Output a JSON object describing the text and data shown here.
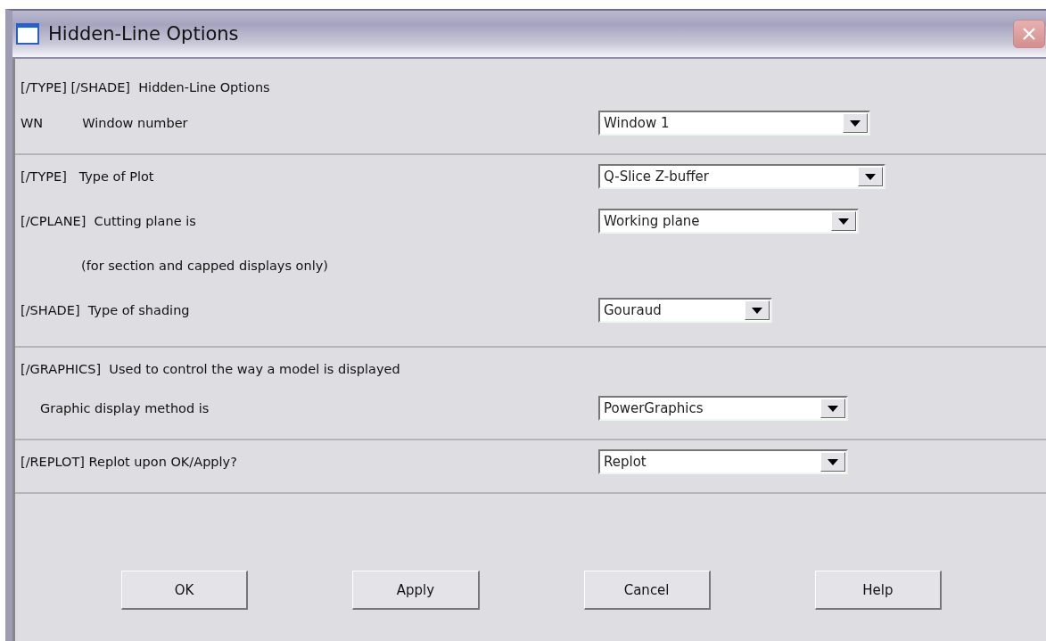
{
  "window": {
    "title": "Hidden-Line Options"
  },
  "sections": [
    {
      "rows": [
        {
          "kind": "heading",
          "label": "[/TYPE] [/SHADE]  Hidden-Line Options"
        },
        {
          "kind": "field",
          "label": "WN",
          "description": "Window number",
          "select": {
            "value": "Window 1"
          }
        }
      ]
    },
    {
      "rows": [
        {
          "kind": "field",
          "label": "[/TYPE]   Type of Plot",
          "select": {
            "value": "Q-Slice Z-buffer"
          }
        },
        {
          "kind": "field",
          "label": "[/CPLANE]  Cutting plane is",
          "select": {
            "value": "Working plane"
          }
        },
        {
          "kind": "note",
          "label": "(for section and capped displays only)"
        },
        {
          "kind": "field",
          "label": "[/SHADE]  Type of shading",
          "select": {
            "value": "Gouraud"
          }
        }
      ]
    },
    {
      "rows": [
        {
          "kind": "heading",
          "label": "[/GRAPHICS]  Used to control the way a model is displayed"
        },
        {
          "kind": "sub",
          "label": "Graphic display method is",
          "select": {
            "value": "PowerGraphics"
          }
        }
      ]
    },
    {
      "rows": [
        {
          "kind": "field",
          "label": "[/REPLOT] Replot upon OK/Apply?",
          "select": {
            "value": "Replot"
          }
        }
      ]
    }
  ],
  "buttons": [
    "OK",
    "Apply",
    "Cancel",
    "Help"
  ]
}
